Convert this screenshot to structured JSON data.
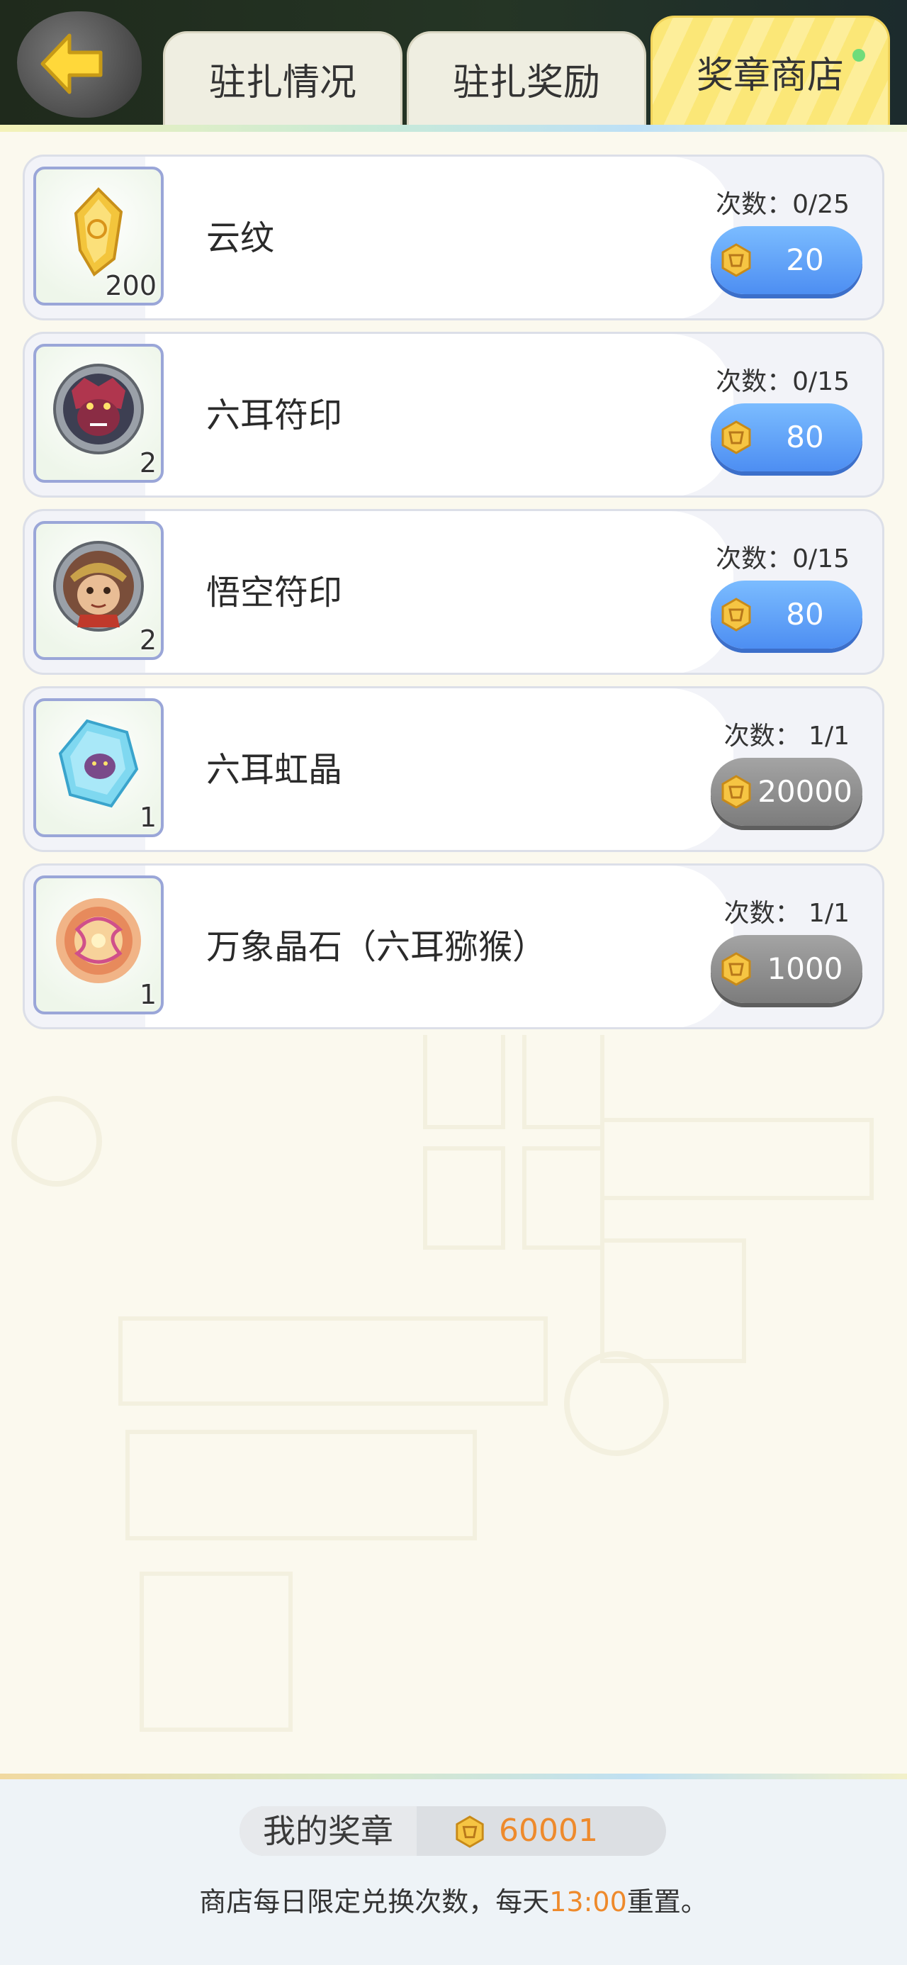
{
  "tabs": [
    {
      "label": "驻扎情况",
      "active": false
    },
    {
      "label": "驻扎奖励",
      "active": false
    },
    {
      "label": "奖章商店",
      "active": true
    }
  ],
  "items": [
    {
      "name": "云纹",
      "count": "200",
      "limit": "次数：0/25",
      "price": "20",
      "price_style": "blue",
      "icon": "cloud-pattern-crystal-icon"
    },
    {
      "name": "六耳符印",
      "count": "2",
      "limit": "次数：0/15",
      "price": "80",
      "price_style": "blue",
      "icon": "six-ear-macaque-seal-icon"
    },
    {
      "name": "悟空符印",
      "count": "2",
      "limit": "次数：0/15",
      "price": "80",
      "price_style": "blue",
      "icon": "wukong-seal-icon"
    },
    {
      "name": "六耳虹晶",
      "count": "1",
      "limit": "次数：  1/1",
      "price": "20000",
      "price_style": "gray",
      "icon": "rainbow-crystal-icon"
    },
    {
      "name": "万象晶石（六耳猕猴）",
      "count": "1",
      "limit": "次数：  1/1",
      "price": "1000",
      "price_style": "gray",
      "icon": "myriad-spar-icon"
    }
  ],
  "footer": {
    "medal_label": "我的奖章",
    "medal_value": "60001",
    "note_prefix": "商店每日限定兑换次数，每天",
    "note_time": "13:00",
    "note_suffix": "重置。"
  },
  "colors": {
    "accent_orange": "#ee8a2c",
    "active_tab_yellow": "#fbe777",
    "button_blue": "#5a9bf6",
    "button_gray": "#8a8a8a"
  }
}
